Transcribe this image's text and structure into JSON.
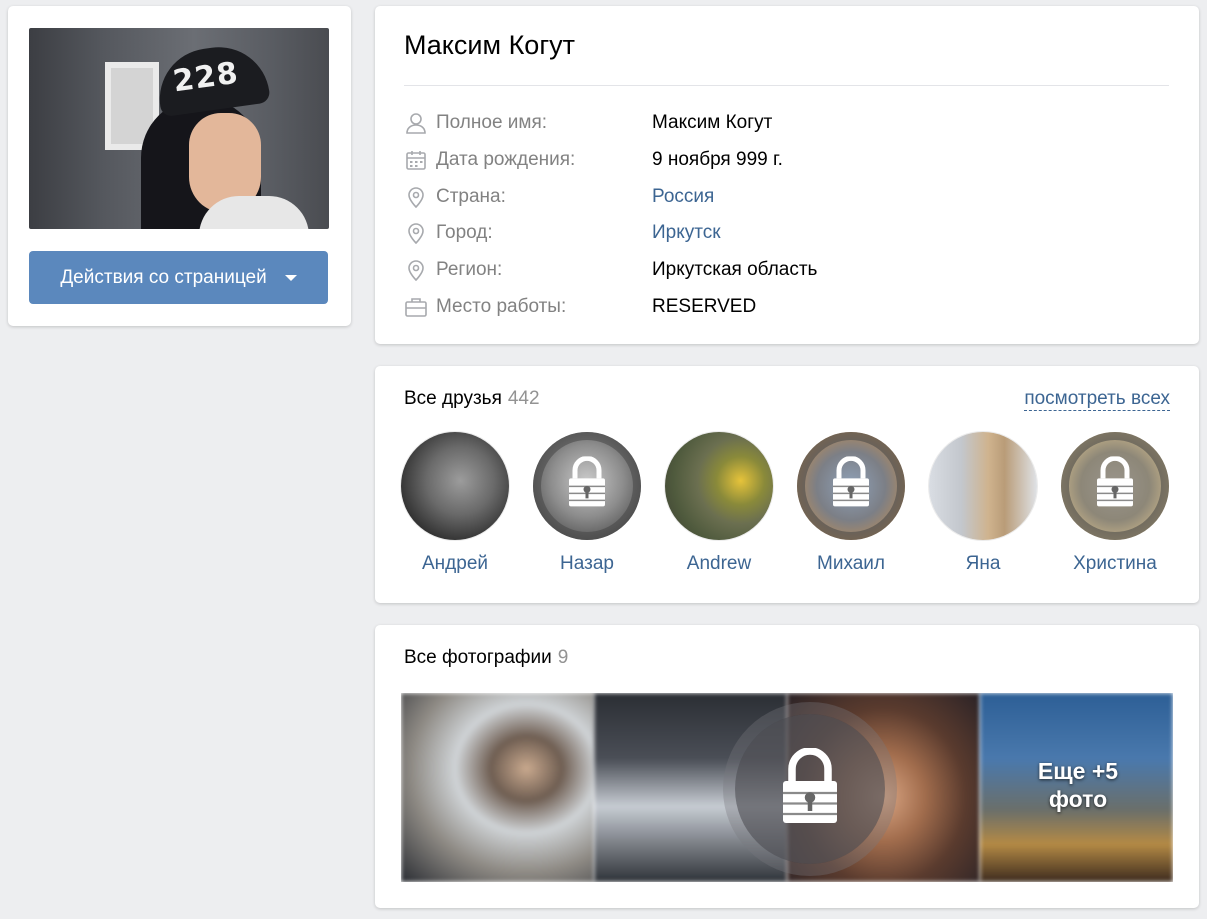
{
  "avatar": {
    "cap_text": "228",
    "actions_label": "Действия со страницей"
  },
  "profile": {
    "name": "Максим Когут",
    "fields": [
      {
        "icon": "user-icon",
        "label": "Полное имя:",
        "value": "Максим Когут",
        "link": false
      },
      {
        "icon": "calendar-icon",
        "label": "Дата рождения:",
        "value": "9 ноября 999 г.",
        "link": false
      },
      {
        "icon": "location-pin-icon",
        "label": "Страна:",
        "value": "Россия",
        "link": true
      },
      {
        "icon": "location-pin-icon",
        "label": "Город:",
        "value": "Иркутск",
        "link": true
      },
      {
        "icon": "location-pin-icon",
        "label": "Регион:",
        "value": "Иркутская область",
        "link": false
      },
      {
        "icon": "briefcase-icon",
        "label": "Место работы:",
        "value": "RESERVED",
        "link": false
      }
    ]
  },
  "friends": {
    "title": "Все друзья",
    "count": "442",
    "see_all": "посмотреть всех",
    "items": [
      {
        "name": "Андрей",
        "locked": false
      },
      {
        "name": "Назар",
        "locked": true
      },
      {
        "name": "Andrew",
        "locked": false
      },
      {
        "name": "Михаил",
        "locked": true
      },
      {
        "name": "Яна",
        "locked": false
      },
      {
        "name": "Христина",
        "locked": true
      }
    ]
  },
  "photos": {
    "title": "Все фотографии",
    "count": "9",
    "more_line1": "Еще +5",
    "more_line2": "фото"
  },
  "colors": {
    "background": "#edeef0",
    "button": "#5b88bd",
    "link": "#3c6592",
    "label": "#828282",
    "count": "#939393"
  }
}
